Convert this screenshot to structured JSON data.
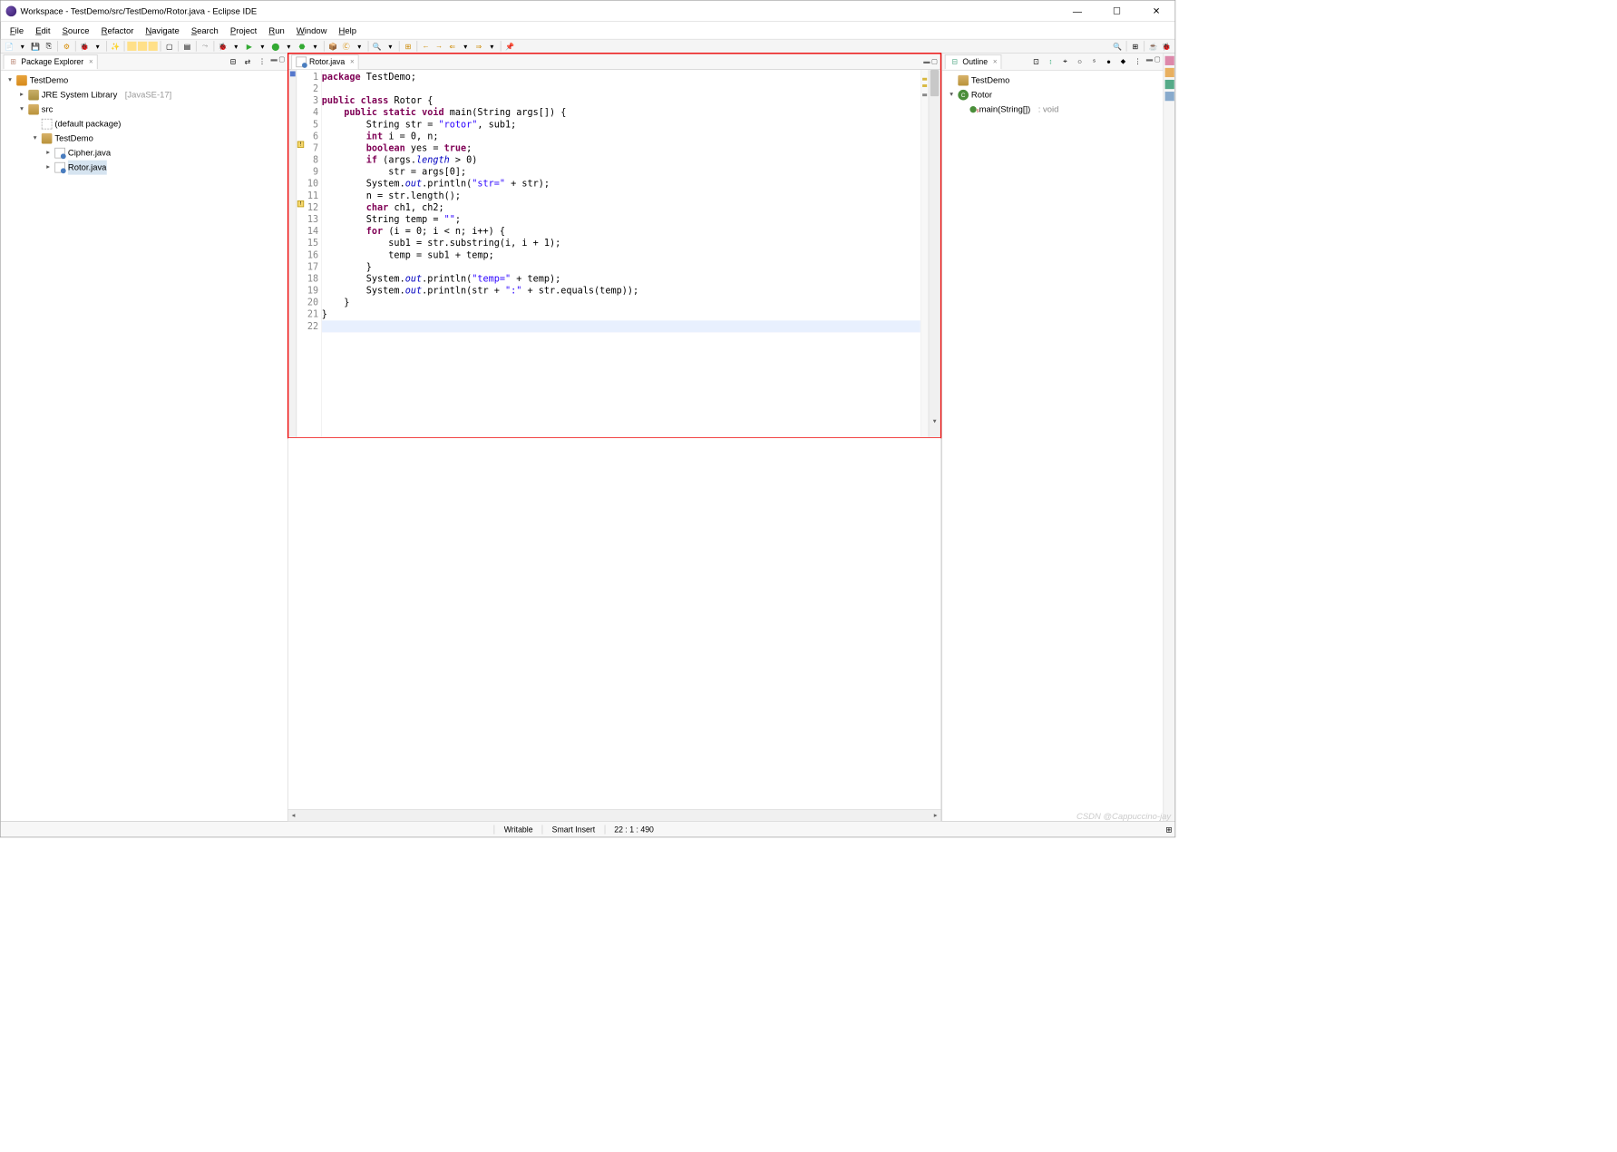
{
  "window": {
    "title": "Workspace - TestDemo/src/TestDemo/Rotor.java - Eclipse IDE"
  },
  "menubar": [
    "File",
    "Edit",
    "Source",
    "Refactor",
    "Navigate",
    "Search",
    "Project",
    "Run",
    "Window",
    "Help"
  ],
  "packageExplorer": {
    "title": "Package Explorer",
    "project": "TestDemo",
    "library": "JRE System Library",
    "librarySuffix": "[JavaSE-17]",
    "src": "src",
    "defaultPkg": "(default package)",
    "pkg": "TestDemo",
    "files": [
      "Cipher.java",
      "Rotor.java"
    ]
  },
  "editor": {
    "tab": "Rotor.java",
    "lines": [
      {
        "n": 1,
        "html": "<span class='kw'>package</span> TestDemo;"
      },
      {
        "n": 2,
        "html": ""
      },
      {
        "n": 3,
        "html": "<span class='kw'>public</span> <span class='kw'>class</span> Rotor {"
      },
      {
        "n": 4,
        "html": "    <span class='kw'>public</span> <span class='kw'>static</span> <span class='kw'>void</span> main(String args[]) {"
      },
      {
        "n": 5,
        "html": "        String str = <span class='str'>\"rotor\"</span>, sub1;"
      },
      {
        "n": 6,
        "html": "        <span class='kw'>int</span> i = 0, n;"
      },
      {
        "n": 7,
        "html": "        <span class='kw'>boolean</span> yes = <span class='kw'>true</span>;",
        "warn": true
      },
      {
        "n": 8,
        "html": "        <span class='kw'>if</span> (args.<span class='fld'>length</span> > 0)"
      },
      {
        "n": 9,
        "html": "            str = args[0];"
      },
      {
        "n": 10,
        "html": "        System.<span class='fld'>out</span>.println(<span class='str'>\"str=\"</span> + str);"
      },
      {
        "n": 11,
        "html": "        n = str.length();"
      },
      {
        "n": 12,
        "html": "        <span class='kw'>char</span> ch1, ch2;",
        "warn": true
      },
      {
        "n": 13,
        "html": "        String temp = <span class='str'>\"\"</span>;"
      },
      {
        "n": 14,
        "html": "        <span class='kw'>for</span> (i = 0; i < n; i++) {"
      },
      {
        "n": 15,
        "html": "            sub1 = str.substring(i, i + 1);"
      },
      {
        "n": 16,
        "html": "            temp = sub1 + temp;"
      },
      {
        "n": 17,
        "html": "        }"
      },
      {
        "n": 18,
        "html": "        System.<span class='fld'>out</span>.println(<span class='str'>\"temp=\"</span> + temp);"
      },
      {
        "n": 19,
        "html": "        System.<span class='fld'>out</span>.println(str + <span class='str'>\":\"</span> + str.equals(temp));"
      },
      {
        "n": 20,
        "html": "    }"
      },
      {
        "n": 21,
        "html": "}"
      },
      {
        "n": 22,
        "html": "",
        "cursor": true
      }
    ]
  },
  "outline": {
    "title": "Outline",
    "pkg": "TestDemo",
    "class": "Rotor",
    "method": "main(String[])",
    "returnType": ": void"
  },
  "status": {
    "writable": "Writable",
    "insert": "Smart Insert",
    "position": "22 : 1 : 490"
  },
  "watermark": "CSDN @Cappuccino-jay"
}
